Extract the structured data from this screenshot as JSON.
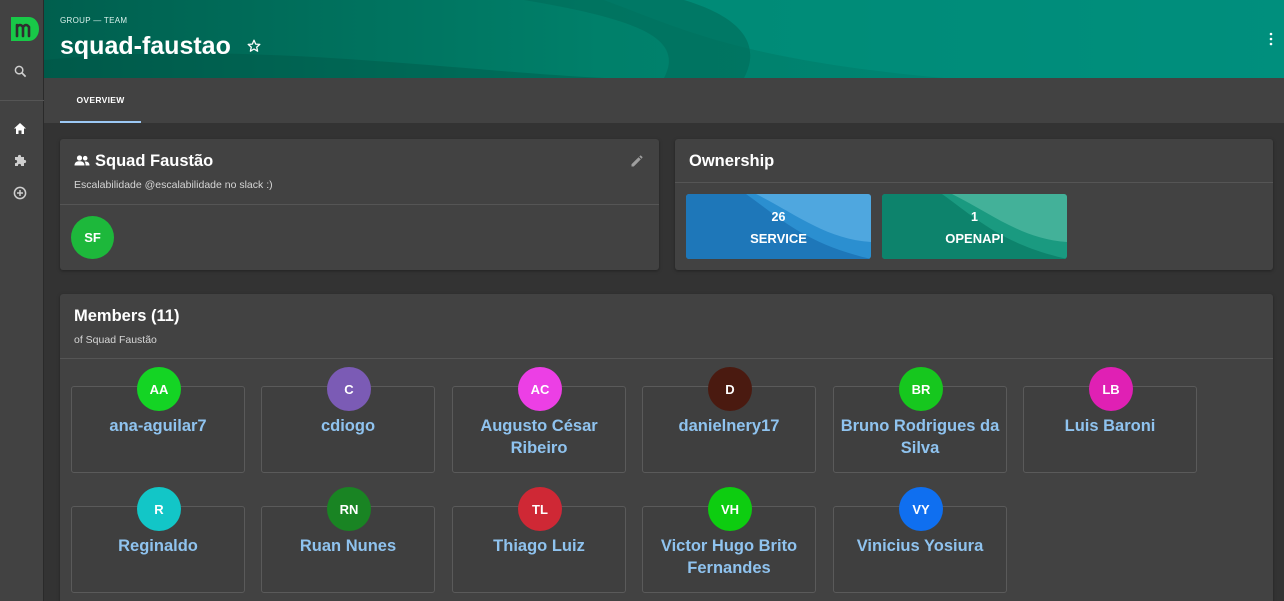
{
  "header": {
    "breadcrumb": "GROUP — TEAM",
    "title": "squad-faustao",
    "gradient_colors": [
      "#005f4e",
      "#00897b"
    ]
  },
  "tabs": [
    {
      "label": "OVERVIEW",
      "active": true
    }
  ],
  "group_card": {
    "title": "Squad Faustão",
    "description": "Escalabilidade @escalabilidade no slack :)",
    "avatar_initials": "SF",
    "avatar_color": "#1db83b"
  },
  "ownership": {
    "title": "Ownership",
    "tiles": [
      {
        "count": "26",
        "label": "SERVICE",
        "color": "#2d8fcf"
      },
      {
        "count": "1",
        "label": "OPENAPI",
        "color": "#1b9e82"
      }
    ]
  },
  "members_card": {
    "title": "Members (11)",
    "subtitle": "of Squad Faustão",
    "members": [
      {
        "initials": "AA",
        "name": "ana-aguilar7",
        "color": "#14d424"
      },
      {
        "initials": "C",
        "name": "cdiogo",
        "color": "#7b5bb5"
      },
      {
        "initials": "AC",
        "name": "Augusto César Ribeiro",
        "color": "#ec3fe5"
      },
      {
        "initials": "D",
        "name": "danielnery17",
        "color": "#4a1a10"
      },
      {
        "initials": "BR",
        "name": "Bruno Rodrigues da Silva",
        "color": "#16c71e"
      },
      {
        "initials": "LB",
        "name": "Luis Baroni",
        "color": "#e020b4"
      },
      {
        "initials": "R",
        "name": "Reginaldo",
        "color": "#12c6c7"
      },
      {
        "initials": "RN",
        "name": "Ruan Nunes",
        "color": "#198423"
      },
      {
        "initials": "TL",
        "name": "Thiago Luiz",
        "color": "#cf2835"
      },
      {
        "initials": "VH",
        "name": "Victor Hugo Brito Fernandes",
        "color": "#0dcd10"
      },
      {
        "initials": "VY",
        "name": "Vinicius Yosiura",
        "color": "#0f6ff0"
      }
    ]
  },
  "sidebar": {
    "items": [
      {
        "icon": "search-icon"
      },
      {
        "icon": "home-icon"
      },
      {
        "icon": "puzzle-icon"
      },
      {
        "icon": "add-circle-icon"
      }
    ]
  },
  "colors": {
    "accent": "#9cc9f5",
    "member_name": "#8fc3ef",
    "logo_green": "#18c948"
  }
}
